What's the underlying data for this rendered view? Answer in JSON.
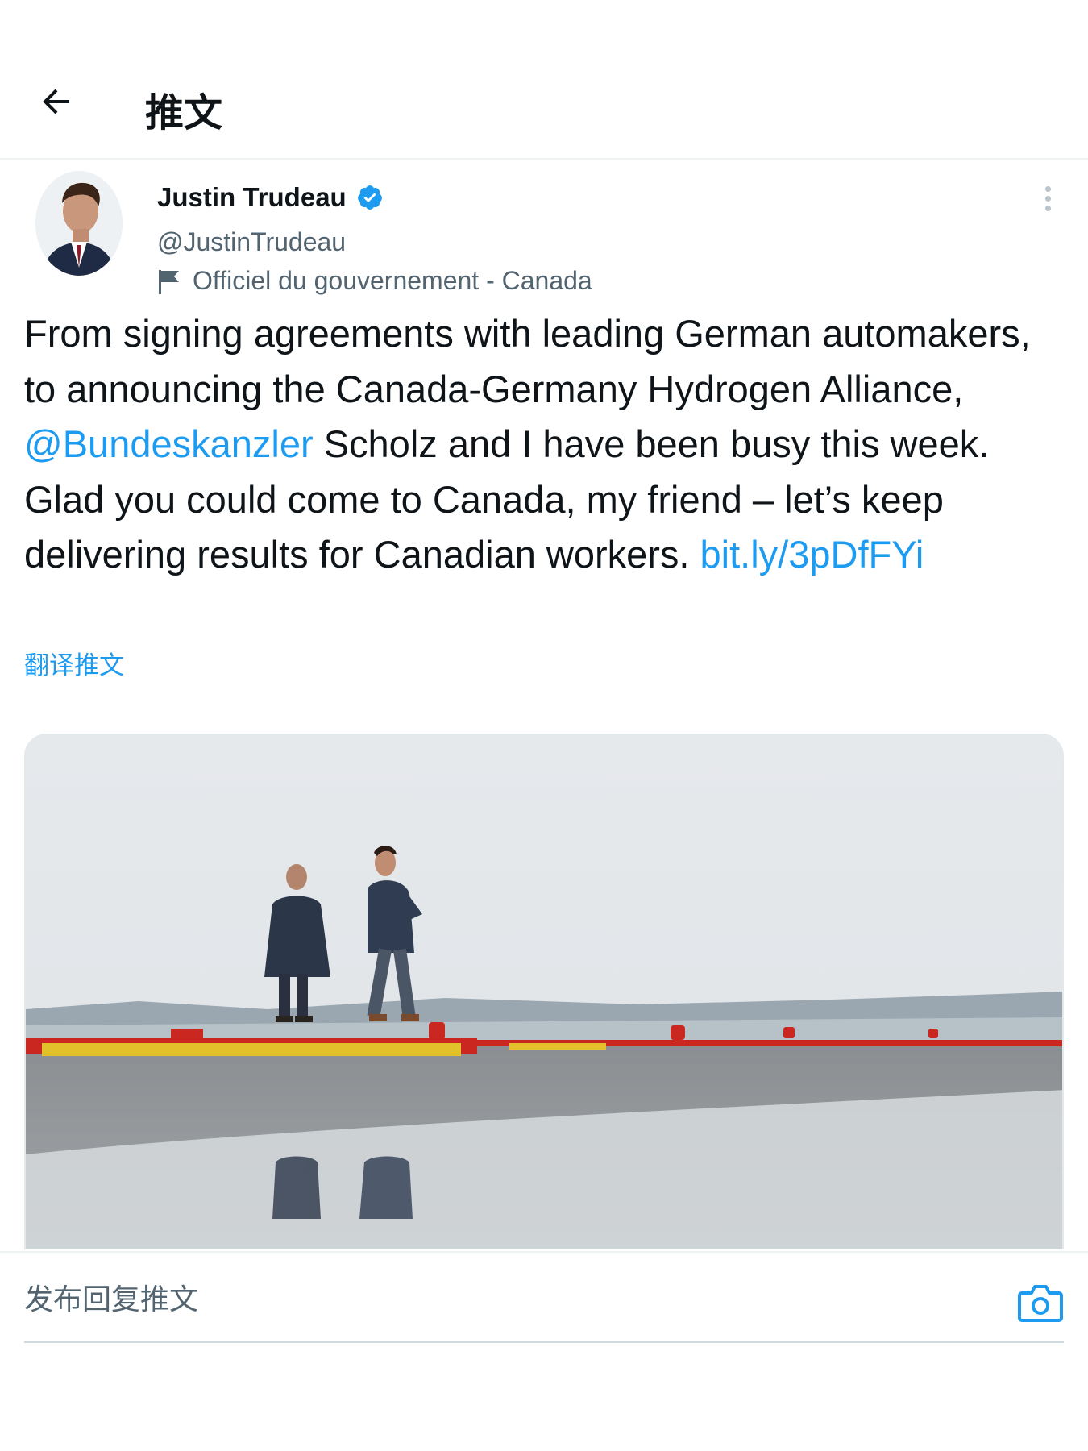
{
  "header": {
    "title": "推文"
  },
  "tweet": {
    "author": {
      "name": "Justin Trudeau",
      "handle": "@JustinTrudeau",
      "verified": true,
      "label": "Officiel du gouvernement - Canada"
    },
    "text_part1": "From signing agreements with leading German automakers, to announcing the Canada-Germany Hydrogen Alliance, ",
    "mention": "@Bundeskanzler",
    "text_part2": " Scholz and I have been busy this week. Glad you could come to Canada, my friend – let’s keep delivering results for Canadian workers. ",
    "link": "bit.ly/3pDfFYi",
    "translate_label": "翻译推文"
  },
  "reply": {
    "placeholder": "发布回复推文"
  },
  "colors": {
    "accent": "#1d9bf0",
    "text_primary": "#0f1419",
    "text_secondary": "#536471",
    "divider": "#eff3f4"
  },
  "icons": {
    "back": "arrow-left-icon",
    "verified": "verified-badge-icon",
    "government": "flag-icon",
    "more": "more-vertical-icon",
    "camera": "camera-icon"
  }
}
